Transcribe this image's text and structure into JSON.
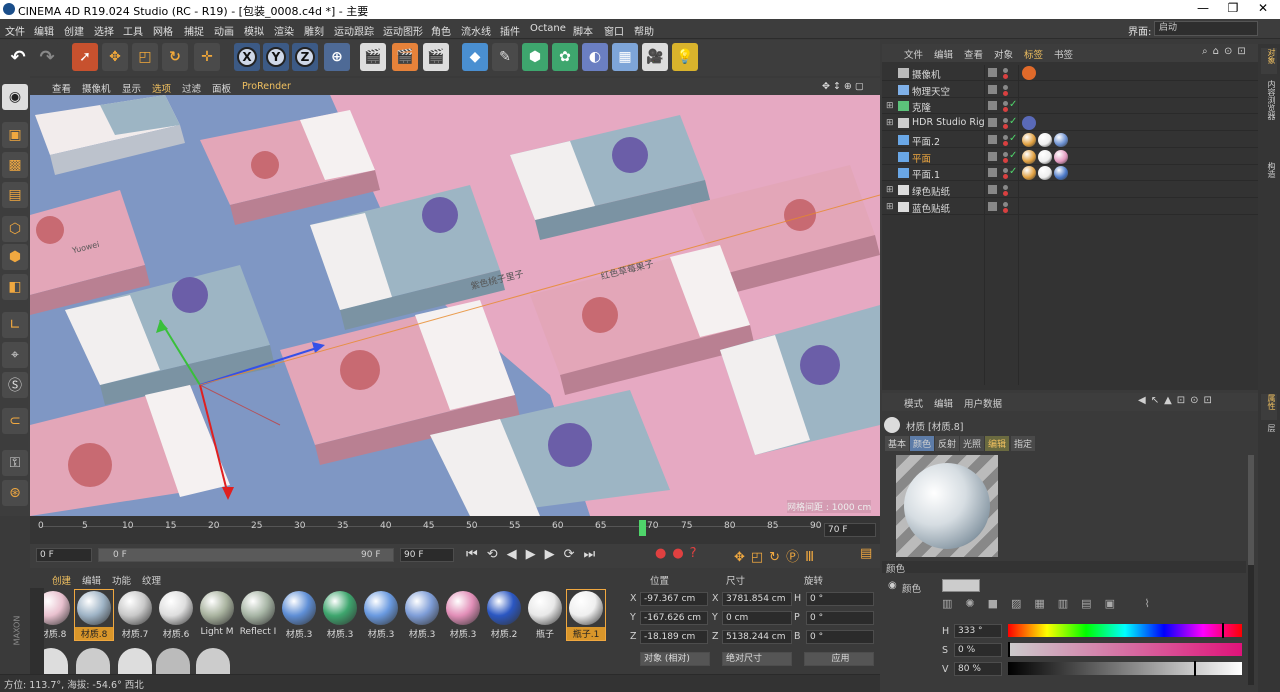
{
  "window": {
    "title": "CINEMA 4D R19.024 Studio (RC - R19) - [包装_0008.c4d *] - 主要",
    "min": "—",
    "max": "❐",
    "close": "✕"
  },
  "menu": {
    "items": [
      "文件",
      "编辑",
      "创建",
      "选择",
      "工具",
      "网格",
      "捕捉",
      "动画",
      "模拟",
      "渲染",
      "雕刻",
      "运动跟踪",
      "运动图形",
      "角色",
      "流水线",
      "插件",
      "Octane",
      "脚本",
      "窗口",
      "帮助"
    ],
    "layout_label": "界面:",
    "layout_value": "启动"
  },
  "toolbar": {
    "undo": "↶",
    "redo": "↷",
    "x": "X",
    "y": "Y",
    "z": "Z"
  },
  "viewport": {
    "menu": [
      "查看",
      "摄像机",
      "显示",
      "选项",
      "过滤",
      "面板",
      "ProRender"
    ],
    "grid_spacing": "网格间距 : 1000 cm"
  },
  "box_labels": {
    "brand": "Yuowei",
    "text1": "紫色桃子里子",
    "text2": "红色草莓果子"
  },
  "timeline": {
    "ticks": [
      "0",
      "5",
      "10",
      "15",
      "20",
      "25",
      "30",
      "35",
      "40",
      "45",
      "50",
      "55",
      "60",
      "65",
      "70",
      "75",
      "80",
      "85",
      "90"
    ],
    "current": "70",
    "current_field": "70 F"
  },
  "playback": {
    "start": "0 F",
    "range_start": "0 F",
    "range_end": "90 F",
    "end": "90 F"
  },
  "materials": {
    "tabs": [
      "创建",
      "编辑",
      "功能",
      "纹理"
    ],
    "items": [
      {
        "label": "材质.8",
        "color": "#e9c1cf"
      },
      {
        "label": "材质.8",
        "color": "#9fb4c6",
        "selected": true
      },
      {
        "label": "材质.7",
        "color": "#c9c9c9"
      },
      {
        "label": "材质.6",
        "color": "#dedede"
      },
      {
        "label": "Light M",
        "color": "#aab4a0"
      },
      {
        "label": "Reflect I",
        "color": "#a8b6a6"
      },
      {
        "label": "材质.3",
        "color": "#5f8fd6"
      },
      {
        "label": "材质.3",
        "color": "#3ea66e"
      },
      {
        "label": "材质.3",
        "color": "#6a9ae0"
      },
      {
        "label": "材质.3",
        "color": "#7f9ed8"
      },
      {
        "label": "材质.3",
        "color": "#e28fb8"
      },
      {
        "label": "材质.2",
        "color": "#2b57c2"
      },
      {
        "label": "瓶子",
        "color": "#e8e8e8"
      },
      {
        "label": "瓶子.1",
        "color": "#efefef",
        "selected": true
      }
    ]
  },
  "coords": {
    "headers": [
      "位置",
      "尺寸",
      "旋转"
    ],
    "rows": [
      {
        "axis": "X",
        "pos": "-97.367 cm",
        "sizeAxis": "X",
        "size": "3781.854 cm",
        "rotAxis": "H",
        "rot": "0 °"
      },
      {
        "axis": "Y",
        "pos": "-167.626 cm",
        "sizeAxis": "Y",
        "size": "0 cm",
        "rotAxis": "P",
        "rot": "0 °"
      },
      {
        "axis": "Z",
        "pos": "-18.189 cm",
        "sizeAxis": "Z",
        "size": "5138.244 cm",
        "rotAxis": "B",
        "rot": "0 °"
      }
    ],
    "mode": "对象 (相对)",
    "size_mode": "绝对尺寸",
    "apply": "应用"
  },
  "status": "方位: 113.7°, 海拔: -54.6° 西北",
  "objects": {
    "menu": [
      "文件",
      "编辑",
      "查看",
      "对象",
      "标签",
      "书签"
    ],
    "rows": [
      {
        "name": "摄像机",
        "icon": "#bbb",
        "expander": ""
      },
      {
        "name": "物理天空",
        "icon": "#7fb0e8",
        "expander": ""
      },
      {
        "name": "克隆",
        "icon": "#5cc27a",
        "expander": "⊞"
      },
      {
        "name": "HDR Studio Rig",
        "icon": "#ccc",
        "expander": "⊞"
      },
      {
        "name": "平面.2",
        "icon": "#6aa7e6",
        "expander": ""
      },
      {
        "name": "平面",
        "icon": "#6aa7e6",
        "expander": "",
        "highlight": true
      },
      {
        "name": "平面.1",
        "icon": "#6aa7e6",
        "expander": ""
      },
      {
        "name": "绿色贴纸",
        "icon": "#ddd",
        "expander": "⊞"
      },
      {
        "name": "蓝色贴纸",
        "icon": "#ddd",
        "expander": "⊞"
      }
    ]
  },
  "attributes": {
    "menu": [
      "模式",
      "编辑",
      "用户数据"
    ],
    "title": "材质 [材质.8]",
    "tabs": [
      "基本",
      "颜色",
      "反射",
      "光照",
      "编辑",
      "指定"
    ],
    "section": "颜色",
    "color_label": "颜色",
    "h_label": "H",
    "h_value": "333 °",
    "s_label": "S",
    "s_value": "0 %",
    "v_label": "V",
    "v_value": "80 %"
  },
  "right_tabs": [
    "对象",
    "内容浏览器",
    "构造",
    "属性",
    "层"
  ]
}
